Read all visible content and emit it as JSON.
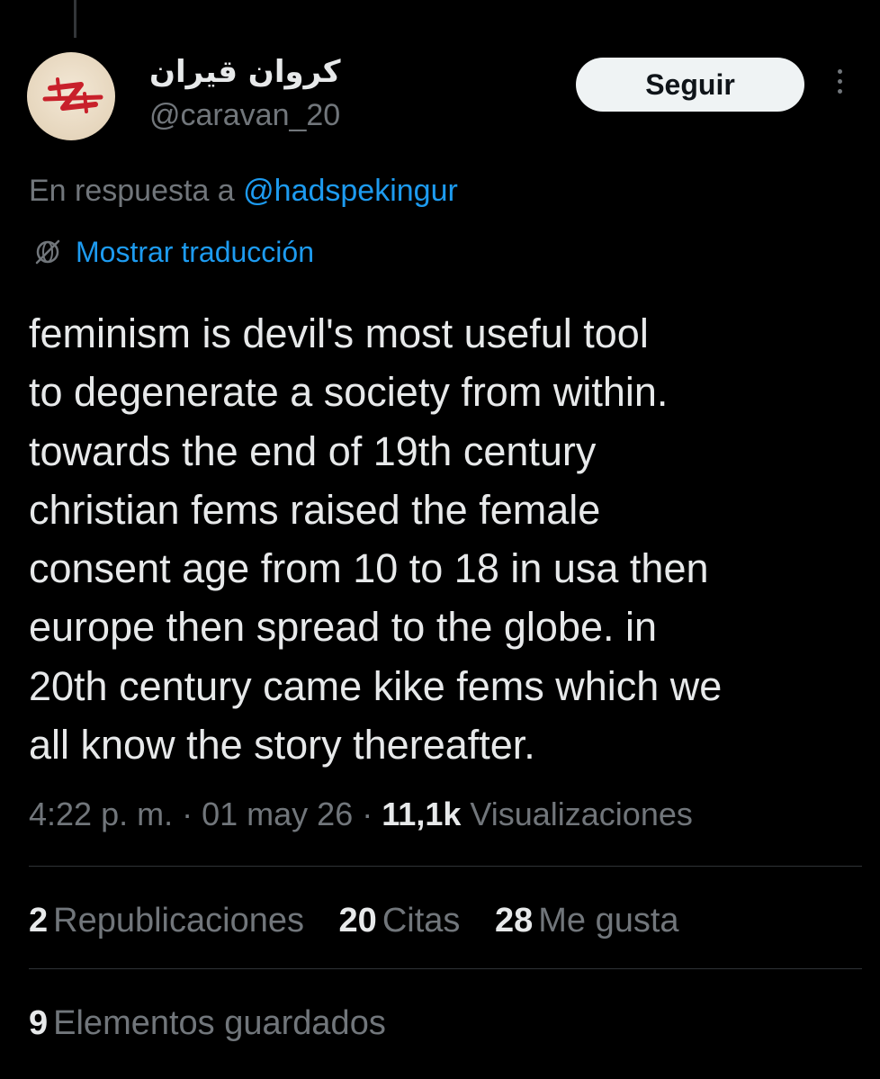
{
  "author": {
    "display_name": "کروان قیران",
    "handle": "@caravan_20",
    "avatar": "red-z-glyph-on-beige"
  },
  "follow_button": {
    "label": "Seguir"
  },
  "more_menu": {
    "icon": "more-dots-vertical-icon"
  },
  "reply_context": {
    "prefix": "En respuesta a",
    "mention": "@hadspekingur"
  },
  "translate": {
    "icon": "globe-icon",
    "label": "Mostrar traducción"
  },
  "tweet": {
    "text": "feminism is devil's most useful tool\nto degenerate a society from within.\ntowards the end of 19th century\nchristian fems raised the female\nconsent age from 10 to 18 in usa then\neurope then spread to the globe. in\n20th century came kike fems which we\nall know the story thereafter."
  },
  "meta": {
    "time": "4:22 p. m.",
    "separator": "·",
    "date": "01 may 26",
    "views_count": "11,1k",
    "views_label": "Visualizaciones"
  },
  "stats": {
    "reposts": {
      "count": "2",
      "label": "Republicaciones"
    },
    "quotes": {
      "count": "20",
      "label": "Citas"
    },
    "likes": {
      "count": "28",
      "label": "Me gusta"
    }
  },
  "bookmarks": {
    "count": "9",
    "label": "Elementos guardados"
  },
  "colors": {
    "background": "#000000",
    "text": "#e7e9ea",
    "secondary": "#71767b",
    "link": "#1d9bf0",
    "divider": "#2f3336",
    "button_bg": "#eff3f4"
  }
}
